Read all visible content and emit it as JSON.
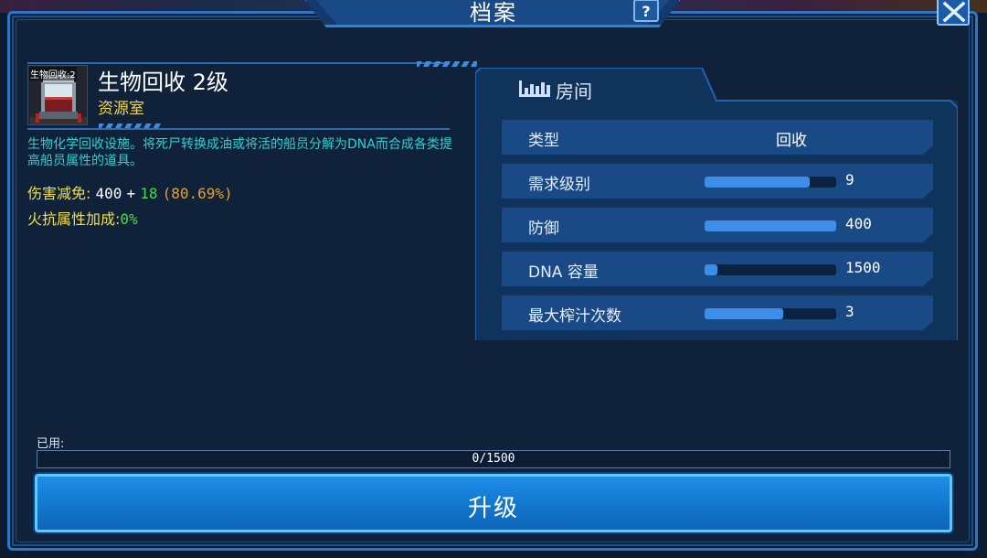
{
  "dialog": {
    "title": "档案",
    "help_label": "?"
  },
  "room": {
    "thumb_label": "生物回收:2",
    "name": "生物回收 2级",
    "category": "资源室",
    "description": "生物化学回收设施。将死尸转换成油或将活的船员分解为DNA而合成各类提高船员属性的道具。",
    "damage_reduction": {
      "label": "伤害减免:",
      "base": "400",
      "plus": "+",
      "bonus": "18",
      "percent": "(80.69%)"
    },
    "fire_resist": {
      "label": "火抗属性加成:",
      "value": "0%"
    }
  },
  "panel": {
    "title": "房间",
    "rows": [
      {
        "label": "类型",
        "value": "回收"
      },
      {
        "label": "需求级别",
        "value": "9",
        "fill": 0.8
      },
      {
        "label": "防御",
        "value": "400",
        "fill": 1.0
      },
      {
        "label": "DNA 容量",
        "value": "1500",
        "fill": 0.1
      },
      {
        "label": "最大榨汁次数",
        "value": "3",
        "fill": 0.6
      }
    ]
  },
  "capacity": {
    "used_label": "已用:",
    "text": "0/1500",
    "fill": 0
  },
  "upgrade": {
    "label": "升级"
  },
  "colors": {
    "accent": "#2a78c8",
    "label_yellow": "#f0e040",
    "desc_cyan": "#2fd0cf",
    "bonus_green": "#4cd84a",
    "percent_orange": "#e8a030",
    "bar_blue": "#3d8ee6"
  }
}
